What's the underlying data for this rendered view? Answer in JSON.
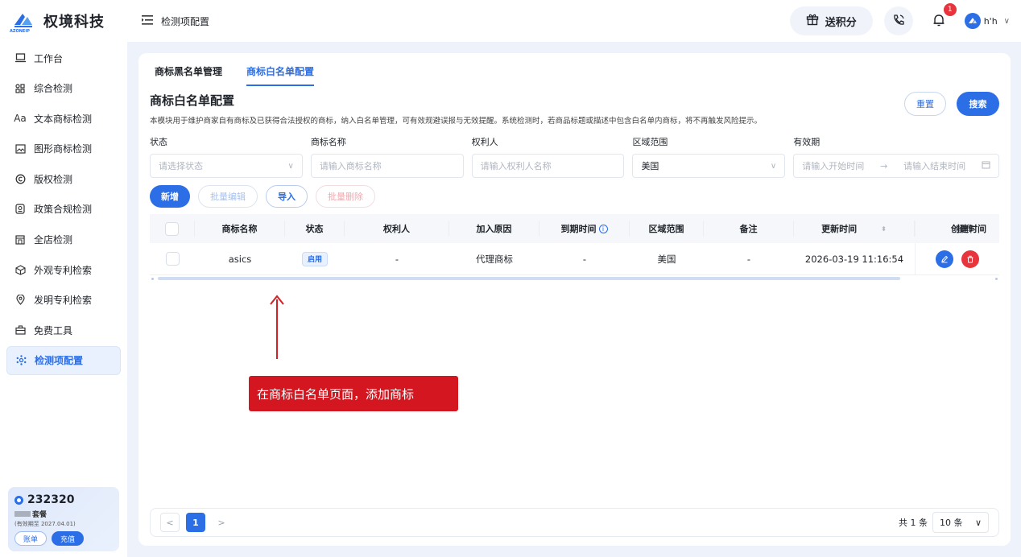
{
  "brand": {
    "name": "权境科技",
    "logo_text": "AZONEIP"
  },
  "sidebar": {
    "items": [
      {
        "label": "工作台",
        "icon": "laptop-icon"
      },
      {
        "label": "综合检测",
        "icon": "grid-icon"
      },
      {
        "label": "文本商标检测",
        "icon": "text-icon"
      },
      {
        "label": "图形商标检测",
        "icon": "image-icon"
      },
      {
        "label": "版权检测",
        "icon": "copyright-icon"
      },
      {
        "label": "政策合规检测",
        "icon": "policy-icon"
      },
      {
        "label": "全店检测",
        "icon": "store-icon"
      },
      {
        "label": "外观专利检索",
        "icon": "cube-icon"
      },
      {
        "label": "发明专利检索",
        "icon": "location-icon"
      },
      {
        "label": "免费工具",
        "icon": "toolbox-icon"
      },
      {
        "label": "检测项配置",
        "icon": "settings-icon",
        "active": true
      }
    ],
    "credits": "232320",
    "plan": "套餐",
    "valid": "(有效期至 2027.04.01)",
    "bill_label": "账单",
    "recharge_label": "充值"
  },
  "header": {
    "title": "检测项配置",
    "gift_label": "送积分",
    "notification_count": "1",
    "user_name": "h'h"
  },
  "tabs": [
    {
      "label": "商标黑名单管理",
      "active": false
    },
    {
      "label": "商标白名单配置",
      "active": true
    }
  ],
  "page": {
    "title": "商标白名单配置",
    "description": "本模块用于维护商家自有商标及已获得合法授权的商标，纳入白名单管理，可有效规避误报与无效提醒。系统检测时，若商品标题或描述中包含白名单内商标，将不再触发风险提示。",
    "reset_label": "重置",
    "search_label": "搜索"
  },
  "filters": {
    "status": {
      "label": "状态",
      "placeholder": "请选择状态"
    },
    "name": {
      "label": "商标名称",
      "placeholder": "请输入商标名称"
    },
    "owner": {
      "label": "权利人",
      "placeholder": "请输入权利人名称"
    },
    "region": {
      "label": "区域范围",
      "value": "美国"
    },
    "validity": {
      "label": "有效期",
      "start_placeholder": "请输入开始时间",
      "end_placeholder": "请输入结束时间"
    }
  },
  "actions": {
    "add": "新增",
    "batch_edit": "批量编辑",
    "import": "导入",
    "batch_delete": "批量删除"
  },
  "table": {
    "columns": [
      "商标名称",
      "状态",
      "权利人",
      "加入原因",
      "到期时间",
      "区域范围",
      "备注",
      "更新时间",
      "创建时间"
    ],
    "overlap_text": "操作",
    "rows": [
      {
        "name": "asics",
        "status": "启用",
        "owner": "-",
        "reason": "代理商标",
        "expiry": "-",
        "region": "美国",
        "note": "-",
        "updated": "2026-03-19 11:16:54"
      }
    ]
  },
  "annotation": {
    "text": "在商标白名单页面，添加商标"
  },
  "pagination": {
    "current": "1",
    "total": "共 1 条",
    "page_size": "10 条"
  },
  "colors": {
    "primary": "#2b6ee6",
    "danger": "#e8343c",
    "annotation": "#d3161f"
  }
}
